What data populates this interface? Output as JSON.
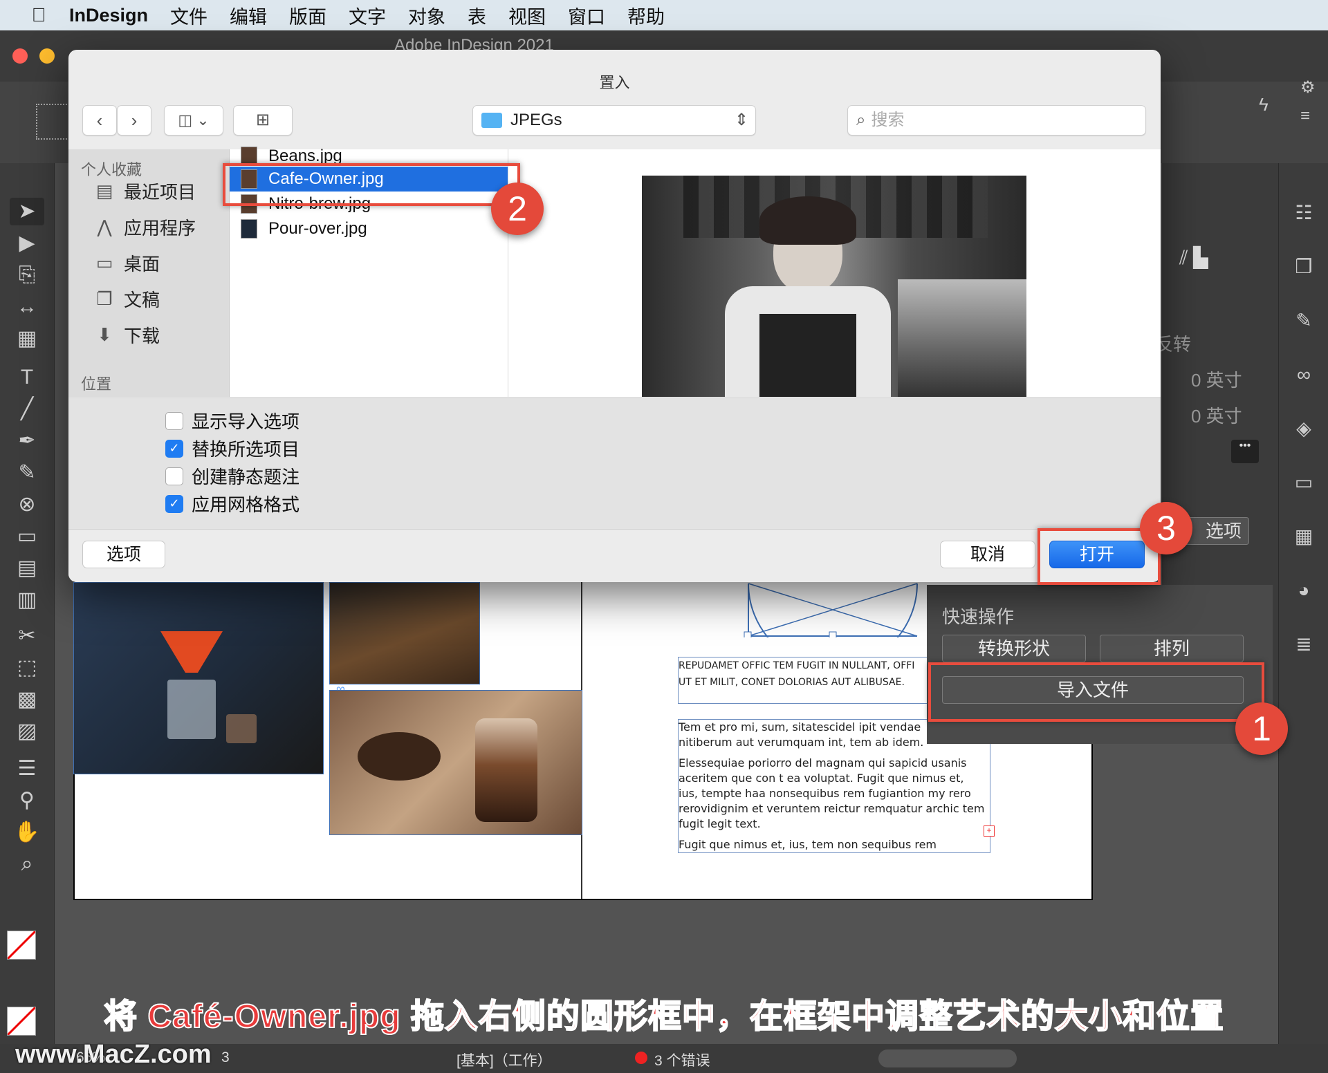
{
  "menubar": {
    "app_name": "InDesign",
    "items": [
      "文件",
      "编辑",
      "版面",
      "文字",
      "对象",
      "表",
      "视图",
      "窗口",
      "帮助"
    ]
  },
  "window": {
    "title": "Adobe InDesign 2021"
  },
  "dialog": {
    "title": "置入",
    "location_popup": "JPEGs",
    "search_placeholder": "搜索",
    "sidebar": {
      "favorites_header": "个人收藏",
      "favorites": [
        "最近项目",
        "应用程序",
        "桌面",
        "文稿",
        "下载"
      ],
      "locations_header": "位置"
    },
    "files": [
      "Beans.jpg",
      "Cafe-Owner.jpg",
      "Nitro-brew.jpg",
      "Pour-over.jpg"
    ],
    "selected_file": "Cafe-Owner.jpg",
    "options": [
      {
        "label": "显示导入选项",
        "checked": false
      },
      {
        "label": "替换所选项目",
        "checked": true
      },
      {
        "label": "创建静态题注",
        "checked": false
      },
      {
        "label": "应用网格格式",
        "checked": true
      }
    ],
    "options_button": "选项",
    "cancel_button": "取消",
    "open_button": "打开"
  },
  "properties": {
    "flip_label": "反转",
    "inch_value_1": "0 英寸",
    "inch_value_2": "0 英寸",
    "options_partial": "选项",
    "quick_actions_title": "快速操作",
    "convert_shape": "转换形状",
    "arrange": "排列",
    "import_file": "导入文件"
  },
  "document": {
    "caps_text": "REPUDAMET OFFIC TEM FUGIT IN NULLANT, OFFI\nUT ET MILIT, CONET DOLORIAS AUT ALIBUSAE.",
    "body_text_1": "Tem et pro mi, sum, sitatescidel ipit vendae\nnitiberum aut verumquam int, tem ab idem.",
    "body_text_2": "Elessequiae poriorro del magnam qui sapicid usanis\naceritem que con t ea voluptat. Fugit que nimus et,\nius, tempte haa nonsequibus rem fugiantion my rero\nrerovidignim et veruntem reictur remquatur archic tem\nfugit legit text.",
    "body_text_3": "Fugit que nimus et, ius, tem non sequibus rem"
  },
  "annotations": {
    "badge_1": "1",
    "badge_2": "2",
    "badge_3": "3",
    "caption": "将 Café-Owner.jpg 拖入右侧的圆形框中，在框架中调整艺术的大小和位置"
  },
  "statusbar": {
    "zoom": "66%",
    "page": "3",
    "mode": "[基本]（工作）",
    "errors": "3 个错误"
  },
  "watermark": "www.MacZ.com",
  "colors": {
    "highlight": "#e84c3d",
    "selection": "#1f6fe0",
    "caption": "#e83b3b"
  }
}
